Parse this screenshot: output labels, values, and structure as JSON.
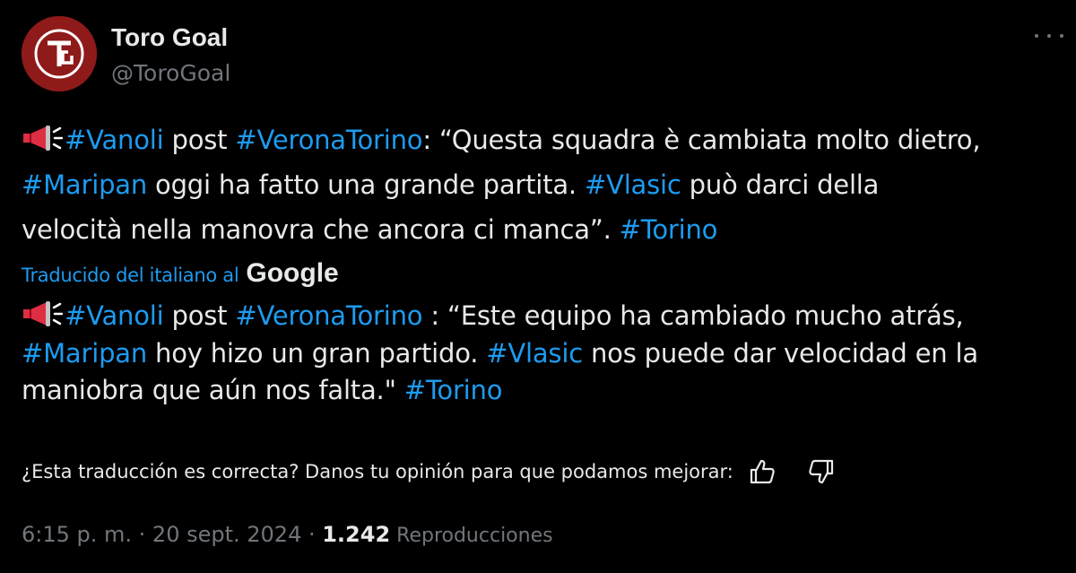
{
  "author": {
    "name": "Toro Goal",
    "handle": "@ToroGoal",
    "avatar_initials": "TG",
    "avatar_color": "#8f1a1a"
  },
  "colors": {
    "accent": "#1d9bf0",
    "text": "#e7e9ea",
    "muted": "#71767b",
    "background": "#000000"
  },
  "icons": {
    "megaphone": "megaphone-icon",
    "more": "more-options-icon",
    "thumbs_up": "thumbs-up-icon",
    "thumbs_down": "thumbs-down-icon"
  },
  "original": {
    "line1": {
      "tag1": "#Vanoli",
      "t1": " post ",
      "tag2": "#VeronaTorino",
      "t2": ": “Questa squadra è cambiata molto dietro,"
    },
    "line2": {
      "tag1": "#Maripan",
      "t1": " oggi ha fatto una grande partita. ",
      "tag2": "#Vlasic",
      "t2": " può darci della"
    },
    "line3": {
      "t1": "velocità nella manovra che ancora ci manca”. ",
      "tag1": "#Torino"
    }
  },
  "translation_attribution": {
    "label": "Traducido del italiano al",
    "brand": "Google"
  },
  "translated": {
    "line1": {
      "tag1": "#Vanoli",
      "t1": " post ",
      "tag2": "#VeronaTorino",
      "t2": " : “Este equipo ha cambiado mucho atrás,"
    },
    "line2": {
      "tag1": "#Maripan",
      "t1": " hoy hizo un gran partido. ",
      "tag2": "#Vlasic",
      "t2": " nos puede dar velocidad en la"
    },
    "line3": {
      "t1": "maniobra que aún nos falta.\" ",
      "tag1": "#Torino"
    }
  },
  "feedback": {
    "question": "¿Esta traducción es correcta? Danos tu opinión para que podamos mejorar:"
  },
  "meta": {
    "time": "6:15 p. m.",
    "sep1": " · ",
    "date": "20 sept. 2024",
    "sep2": " · ",
    "views_count": "1.242",
    "views_label": " Reproducciones"
  }
}
